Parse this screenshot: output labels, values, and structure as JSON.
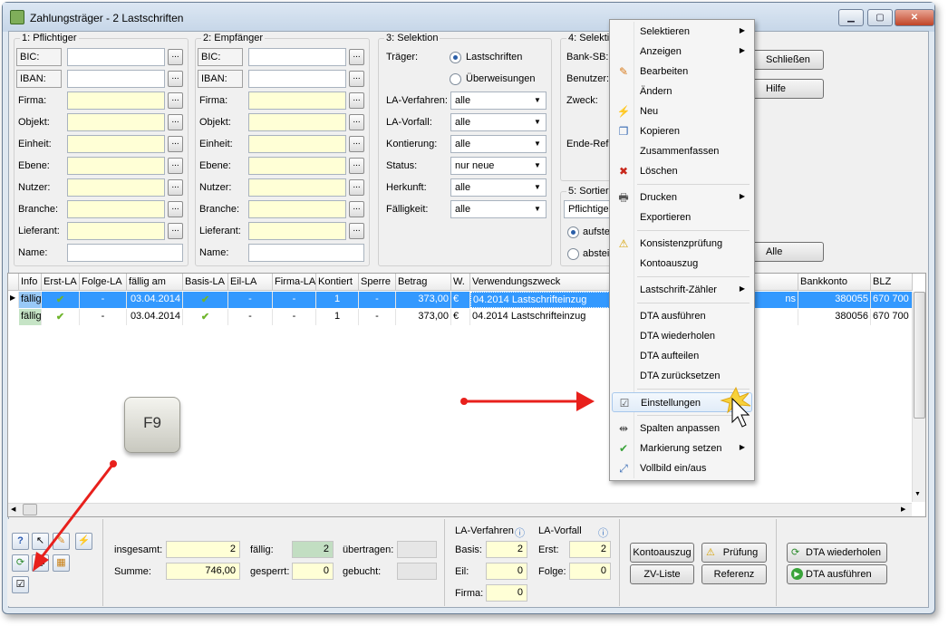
{
  "window": {
    "title": "Zahlungsträger - 2 Lastschriften",
    "minimize": "▁",
    "maximize": "▢",
    "close": "✕"
  },
  "pflichtiger": {
    "title": "1: Pflichtiger",
    "fields": [
      "BIC:",
      "IBAN:",
      "Firma:",
      "Objekt:",
      "Einheit:",
      "Ebene:",
      "Nutzer:",
      "Branche:",
      "Lieferant:",
      "Name:"
    ]
  },
  "empfaenger": {
    "title": "2: Empfänger",
    "fields": [
      "BIC:",
      "IBAN:",
      "Firma:",
      "Objekt:",
      "Einheit:",
      "Ebene:",
      "Nutzer:",
      "Branche:",
      "Lieferant:",
      "Name:"
    ]
  },
  "selektion": {
    "title": "3: Selektion",
    "traeger_label": "Träger:",
    "radio1": "Lastschriften",
    "radio2": "Überweisungen",
    "rows": [
      {
        "label": "LA-Verfahren:",
        "value": "alle"
      },
      {
        "label": "LA-Vorfall:",
        "value": "alle"
      },
      {
        "label": "Kontierung:",
        "value": "alle"
      },
      {
        "label": "Status:",
        "value": "nur neue"
      },
      {
        "label": "Herkunft:",
        "value": "alle"
      },
      {
        "label": "Fälligkeit:",
        "value": "alle"
      }
    ]
  },
  "selektion4": {
    "title": "4: Selekti",
    "bank": "Bank-SB:",
    "benutzer": "Benutzer:",
    "zweck": "Zweck:",
    "ende": "Ende-Ref."
  },
  "sortierung": {
    "title": "5: Sortieru",
    "select": "Pflichtige",
    "radio1": "aufstei",
    "radio2": "absteig"
  },
  "buttons": {
    "schliessen": "Schließen",
    "hilfe": "Hilfe",
    "alle": "Alle"
  },
  "grid": {
    "headers": [
      "Info",
      "Erst-LA",
      "Folge-LA",
      "fällig am",
      "Basis-LA",
      "Eil-LA",
      "Firma-LA",
      "Kontiert",
      "Sperre",
      "Betrag",
      "W.",
      "Verwendungszweck",
      "Bankkonto",
      "BLZ"
    ],
    "rows": [
      {
        "info": "fällig",
        "folge": "-",
        "faellig": "03.04.2014",
        "eil": "-",
        "firma": "-",
        "kontiert": "1",
        "sperre": "-",
        "betrag": "373,00",
        "w": "€",
        "zweck": "04.2014 Lastschrifteinzug",
        "tail": "ns",
        "bankkonto": "380055",
        "blz": "670 700"
      },
      {
        "info": "fällig",
        "folge": "-",
        "faellig": "03.04.2014",
        "eil": "-",
        "firma": "-",
        "kontiert": "1",
        "sperre": "-",
        "betrag": "373,00",
        "w": "€",
        "zweck": "04.2014 Lastschrifteinzug",
        "tail": "",
        "bankkonto": "380056",
        "blz": "670 700"
      }
    ]
  },
  "key": "F9",
  "menu": {
    "items": [
      {
        "label": "Selektieren",
        "sub": true,
        "icon": ""
      },
      {
        "label": "Anzeigen",
        "sub": true,
        "icon": ""
      },
      {
        "label": "Bearbeiten",
        "sub": false,
        "icon": "✎"
      },
      {
        "label": "Ändern",
        "sub": false,
        "icon": ""
      },
      {
        "label": "Neu",
        "sub": false,
        "icon": "⚡"
      },
      {
        "label": "Kopieren",
        "sub": false,
        "icon": "❐"
      },
      {
        "label": "Zusammenfassen",
        "sub": false,
        "icon": ""
      },
      {
        "label": "Löschen",
        "sub": false,
        "icon": "✖"
      },
      {
        "label": "Drucken",
        "sub": true,
        "icon": "🖶"
      },
      {
        "label": "Exportieren",
        "sub": false,
        "icon": ""
      },
      {
        "label": "Konsistenzprüfung",
        "sub": false,
        "icon": "⚠"
      },
      {
        "label": "Kontoauszug",
        "sub": false,
        "icon": ""
      },
      {
        "label": "Lastschrift-Zähler",
        "sub": true,
        "icon": ""
      },
      {
        "label": "DTA ausführen",
        "sub": false,
        "icon": ""
      },
      {
        "label": "DTA wiederholen",
        "sub": false,
        "icon": ""
      },
      {
        "label": "DTA aufteilen",
        "sub": false,
        "icon": ""
      },
      {
        "label": "DTA zurücksetzen",
        "sub": false,
        "icon": ""
      },
      {
        "label": "Einstellungen",
        "sub": false,
        "icon": "☑"
      },
      {
        "label": "Spalten anpassen",
        "sub": false,
        "icon": "⇹"
      },
      {
        "label": "Markierung setzen",
        "sub": true,
        "icon": "✔"
      },
      {
        "label": "Vollbild ein/aus",
        "sub": false,
        "icon": "⤢"
      }
    ]
  },
  "summary": {
    "insgesamt_label": "insgesamt:",
    "insgesamt": "2",
    "summe_label": "Summe:",
    "summe": "746,00",
    "faellig_label": "fällig:",
    "faellig": "2",
    "gesperrt_label": "gesperrt:",
    "gesperrt": "0",
    "uebertragen_label": "übertragen:",
    "uebertragen": "",
    "gebucht_label": "gebucht:",
    "gebucht": "",
    "laverf_title": "LA-Verfahren",
    "lavorfall_title": "LA-Vorfall",
    "basis_label": "Basis:",
    "basis": "2",
    "eil_label": "Eil:",
    "eil": "0",
    "firma_label": "Firma:",
    "firma": "0",
    "erst_label": "Erst:",
    "erst": "2",
    "folge_label": "Folge:",
    "folge": "0"
  },
  "actions": {
    "kontoauszug": "Kontoauszug",
    "pruefung": "Prüfung",
    "zvliste": "ZV-Liste",
    "referenz": "Referenz",
    "dta_wiederholen": "DTA wiederholen",
    "dta_ausfuehren": "DTA ausführen"
  },
  "colors": {
    "selection": "#3399ff",
    "yellow_field": "#ffffd6",
    "arrow": "#e8201c"
  }
}
